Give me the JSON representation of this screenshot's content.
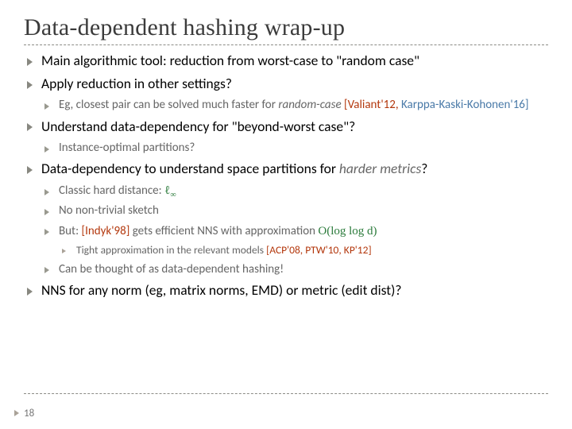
{
  "title": "Data-dependent hashing wrap-up",
  "b1": "Main algorithmic tool: reduction from worst-case to \"random case\"",
  "b2": "Apply reduction in other settings?",
  "b2a_pre": "Eg, closest pair can be solved much faster for ",
  "b2a_ital": "random-case",
  "b2a_ref1": " [Valiant'12, ",
  "b2a_ref2": "Karppa-Kaski-Kohonen'16]",
  "b3": "Understand data-dependency for \"beyond-worst case\"?",
  "b3a": "Instance-optimal partitions?",
  "b4_pre": "Data-dependency to understand space partitions for ",
  "b4_ital": "harder metrics",
  "b4_post": "?",
  "b4a_pre": "Classic hard distance: ",
  "b4a_math": "ℓ",
  "b4a_sub": "∞",
  "b4b": "No non-trivial sketch",
  "b4c_pre": "But: ",
  "b4c_ref": "[Indyk'98]",
  "b4c_mid": " gets efficient NNS with  approximation ",
  "b4c_math": "O(log log d)",
  "b4c1_pre": "Tight approximation in the relevant models ",
  "b4c1_ref": "[ACP'08, PTW'10, KP'12]",
  "b4d": "Can be thought of as data-dependent hashing!",
  "b5": "NNS for any norm (eg, matrix norms, EMD) or metric (edit dist)?",
  "page_number": "18"
}
